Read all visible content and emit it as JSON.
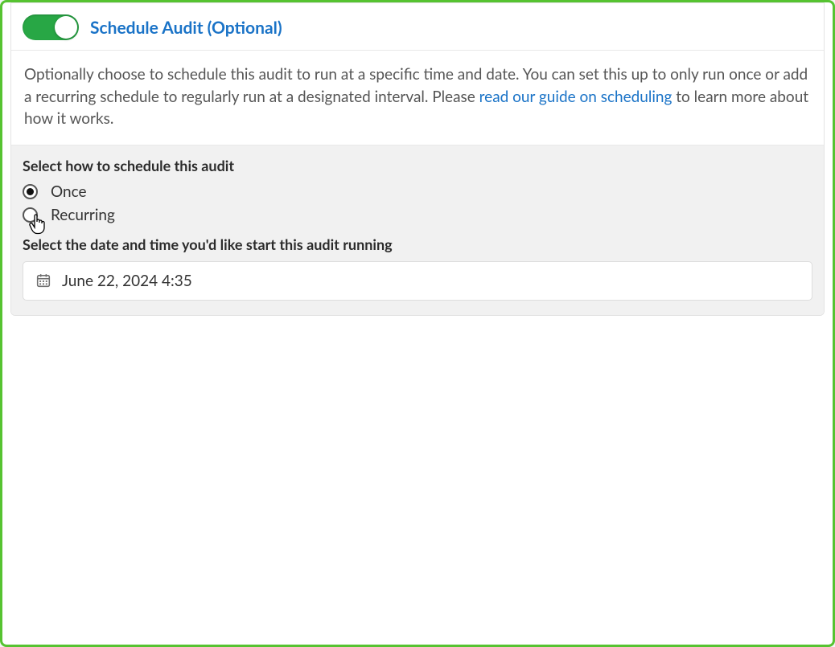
{
  "header": {
    "title": "Schedule Audit (Optional)",
    "toggle_on": true
  },
  "description": {
    "text_before_link": "Optionally choose to schedule this audit to run at a specific time and date. You can set this up to only run once or add a recurring schedule to regularly run at a designated interval. Please ",
    "link_text": "read our guide on scheduling",
    "text_after_link": " to learn more about how it works."
  },
  "form": {
    "schedule_type_label": "Select how to schedule this audit",
    "options": {
      "once": "Once",
      "recurring": "Recurring"
    },
    "selected_option": "once",
    "datetime_label": "Select the date and time you'd like start this audit running",
    "datetime_value": "June 22, 2024 4:35"
  },
  "colors": {
    "accent_green": "#28a745",
    "accent_blue": "#1a73c7",
    "border_green": "#56c331"
  }
}
